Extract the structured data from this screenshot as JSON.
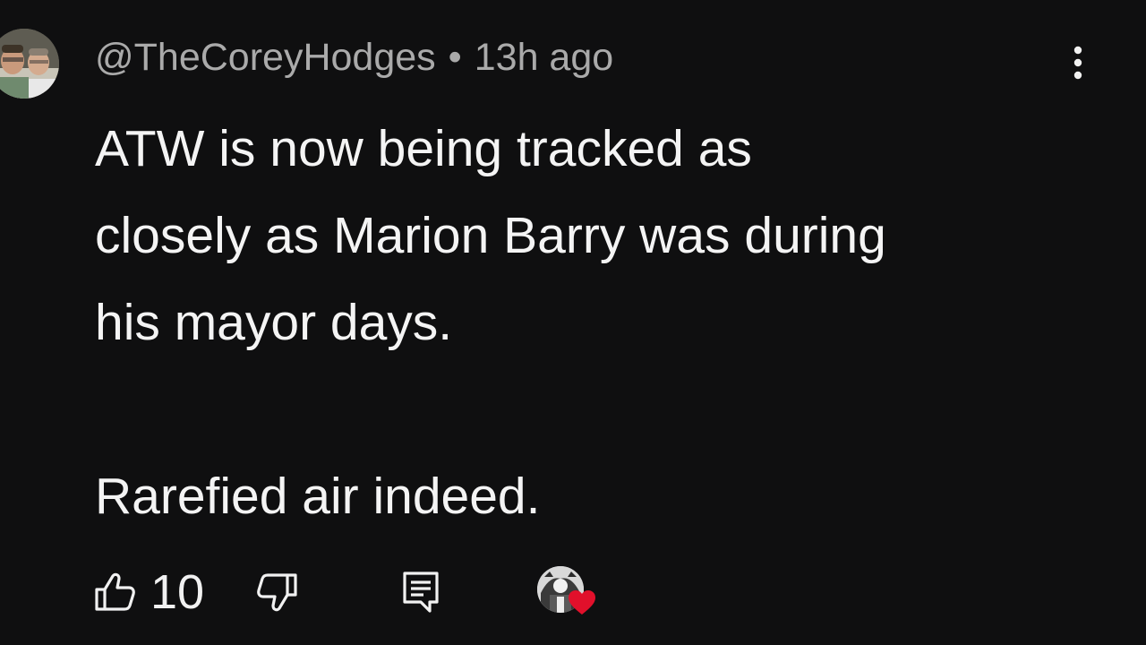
{
  "comment": {
    "author": "@TheCoreyHodges",
    "separator": "•",
    "timestamp": "13h ago",
    "text": "ATW is now being tracked as\nclosely as Marion Barry was during\nhis mayor days.\n\nRarefied air indeed.",
    "avatar_icon": "user-avatar",
    "more_icon": "vertical-dots-icon"
  },
  "actions": {
    "like_icon": "thumbs-up-icon",
    "like_count": "10",
    "dislike_icon": "thumbs-down-icon",
    "reply_icon": "reply-comment-icon",
    "creator_heart_icon": "creator-heart-badge",
    "heart_color": "#e1102b"
  },
  "colors": {
    "background": "#0f0f10",
    "text": "#f4f4f4",
    "secondary_text": "#aaaaaa"
  }
}
